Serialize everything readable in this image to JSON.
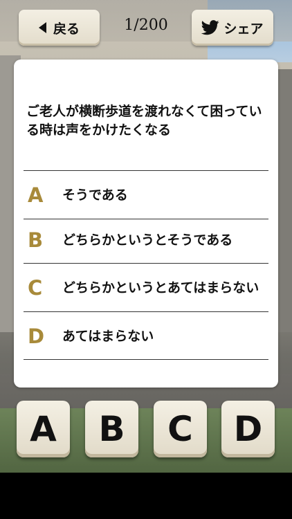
{
  "header": {
    "back_label": "戻る",
    "counter": "1/200",
    "share_label": "シェア"
  },
  "question": {
    "text": "ご老人が横断歩道を渡れなくて困っている時は声をかけたくなる"
  },
  "options": [
    {
      "letter": "A",
      "text": "そうである"
    },
    {
      "letter": "B",
      "text": "どちらかというとそうである"
    },
    {
      "letter": "C",
      "text": "どちらかというとあてはまらない"
    },
    {
      "letter": "D",
      "text": "あてはまらない"
    }
  ],
  "answer_buttons": [
    "A",
    "B",
    "C",
    "D"
  ],
  "colors": {
    "option_letter": "#a88a3a",
    "button_face": "#ede7d8",
    "twitter_icon": "#111111"
  },
  "icons": {
    "back": "back-triangle-icon",
    "share": "twitter-bird-icon"
  }
}
